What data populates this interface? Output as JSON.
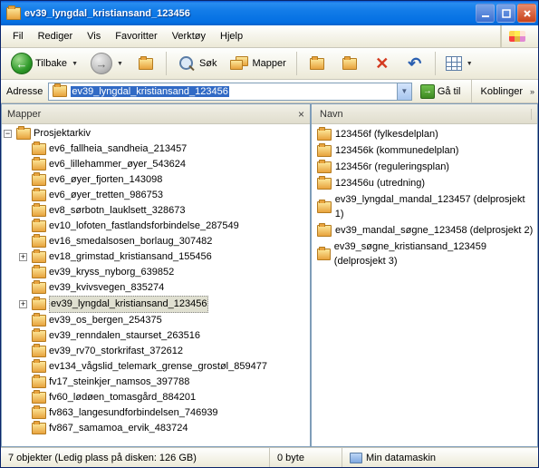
{
  "window": {
    "title": "ev39_lyngdal_kristiansand_123456"
  },
  "menu": {
    "items": [
      "Fil",
      "Rediger",
      "Vis",
      "Favoritter",
      "Verktøy",
      "Hjelp"
    ]
  },
  "toolbar": {
    "back": "Tilbake",
    "search": "Søk",
    "folders": "Mapper"
  },
  "address": {
    "label": "Adresse",
    "value": "ev39_lyngdal_kristiansand_123456",
    "go": "Gå til",
    "links": "Koblinger"
  },
  "leftPane": {
    "title": "Mapper",
    "close": "×"
  },
  "tree": {
    "root": "Prosjektarkiv",
    "children": [
      {
        "label": "ev6_fallheia_sandheia_213457",
        "exp": ""
      },
      {
        "label": "ev6_lillehammer_øyer_543624",
        "exp": ""
      },
      {
        "label": "ev6_øyer_fjorten_143098",
        "exp": ""
      },
      {
        "label": "ev6_øyer_tretten_986753",
        "exp": ""
      },
      {
        "label": "ev8_sørbotn_lauklsett_328673",
        "exp": ""
      },
      {
        "label": "ev10_lofoten_fastlandsforbindelse_287549",
        "exp": ""
      },
      {
        "label": "ev16_smedalsosen_borlaug_307482",
        "exp": ""
      },
      {
        "label": "ev18_grimstad_kristiansand_155456",
        "exp": "+"
      },
      {
        "label": "ev39_kryss_nyborg_639852",
        "exp": ""
      },
      {
        "label": "ev39_kvivsvegen_835274",
        "exp": ""
      },
      {
        "label": "ev39_lyngdal_kristiansand_123456",
        "exp": "+",
        "selected": true
      },
      {
        "label": "ev39_os_bergen_254375",
        "exp": ""
      },
      {
        "label": "ev39_renndalen_staurset_263516",
        "exp": ""
      },
      {
        "label": "ev39_rv70_storkrifast_372612",
        "exp": ""
      },
      {
        "label": "ev134_vågslid_telemark_grense_grostøl_859477",
        "exp": ""
      },
      {
        "label": "fv17_steinkjer_namsos_397788",
        "exp": ""
      },
      {
        "label": "fv60_lødøen_tomasgård_884201",
        "exp": ""
      },
      {
        "label": "fv863_langesundforbindelsen_746939",
        "exp": ""
      },
      {
        "label": "fv867_samamoa_ervik_483724",
        "exp": ""
      }
    ]
  },
  "rightPane": {
    "nameCol": "Navn"
  },
  "files": [
    {
      "label": "123456f (fylkesdelplan)"
    },
    {
      "label": "123456k (kommunedelplan)"
    },
    {
      "label": "123456r (reguleringsplan)"
    },
    {
      "label": "123456u (utredning)"
    },
    {
      "label": "ev39_lyngdal_mandal_123457 (delprosjekt 1)"
    },
    {
      "label": "ev39_mandal_søgne_123458 (delprosjekt 2)"
    },
    {
      "label": "ev39_søgne_kristiansand_123459 (delprosjekt 3)"
    }
  ],
  "status": {
    "left": "7 objekter (Ledig plass på disken: 126 GB)",
    "mid": "0 byte",
    "right": "Min datamaskin"
  }
}
